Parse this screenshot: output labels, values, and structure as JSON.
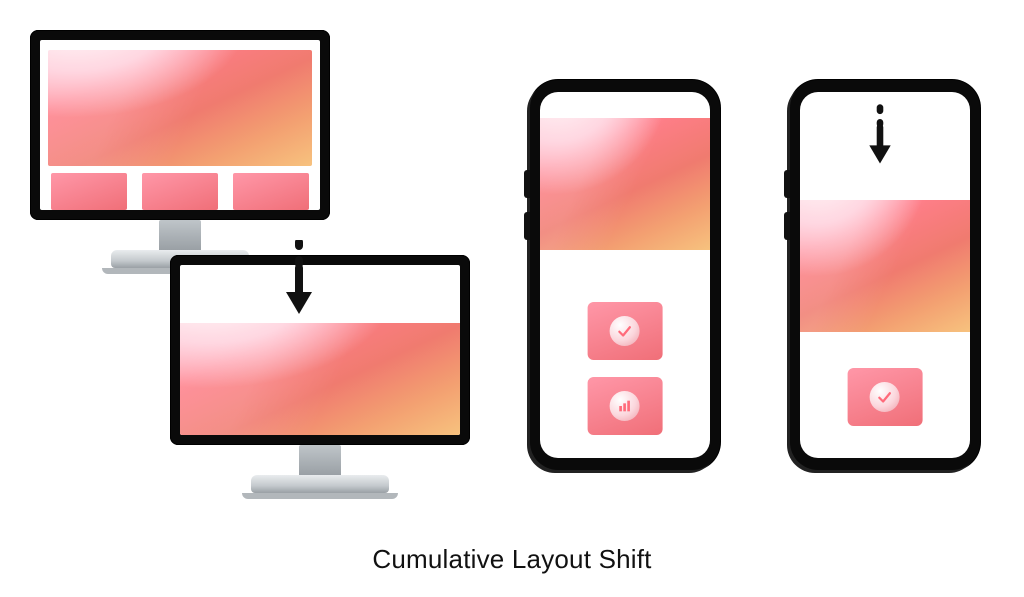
{
  "caption": "Cumulative Layout Shift",
  "devices": {
    "desktop_before": {
      "state": "before layout shift",
      "thumbnails": 3
    },
    "desktop_after": {
      "state": "after layout shift"
    },
    "phone_before": {
      "state": "before layout shift",
      "tiles": [
        "check",
        "bars"
      ]
    },
    "phone_after": {
      "state": "after layout shift",
      "tiles": [
        "check"
      ]
    }
  },
  "icons": {
    "check": "check-icon",
    "bars": "bar-chart-icon",
    "arrow": "arrow-down"
  }
}
